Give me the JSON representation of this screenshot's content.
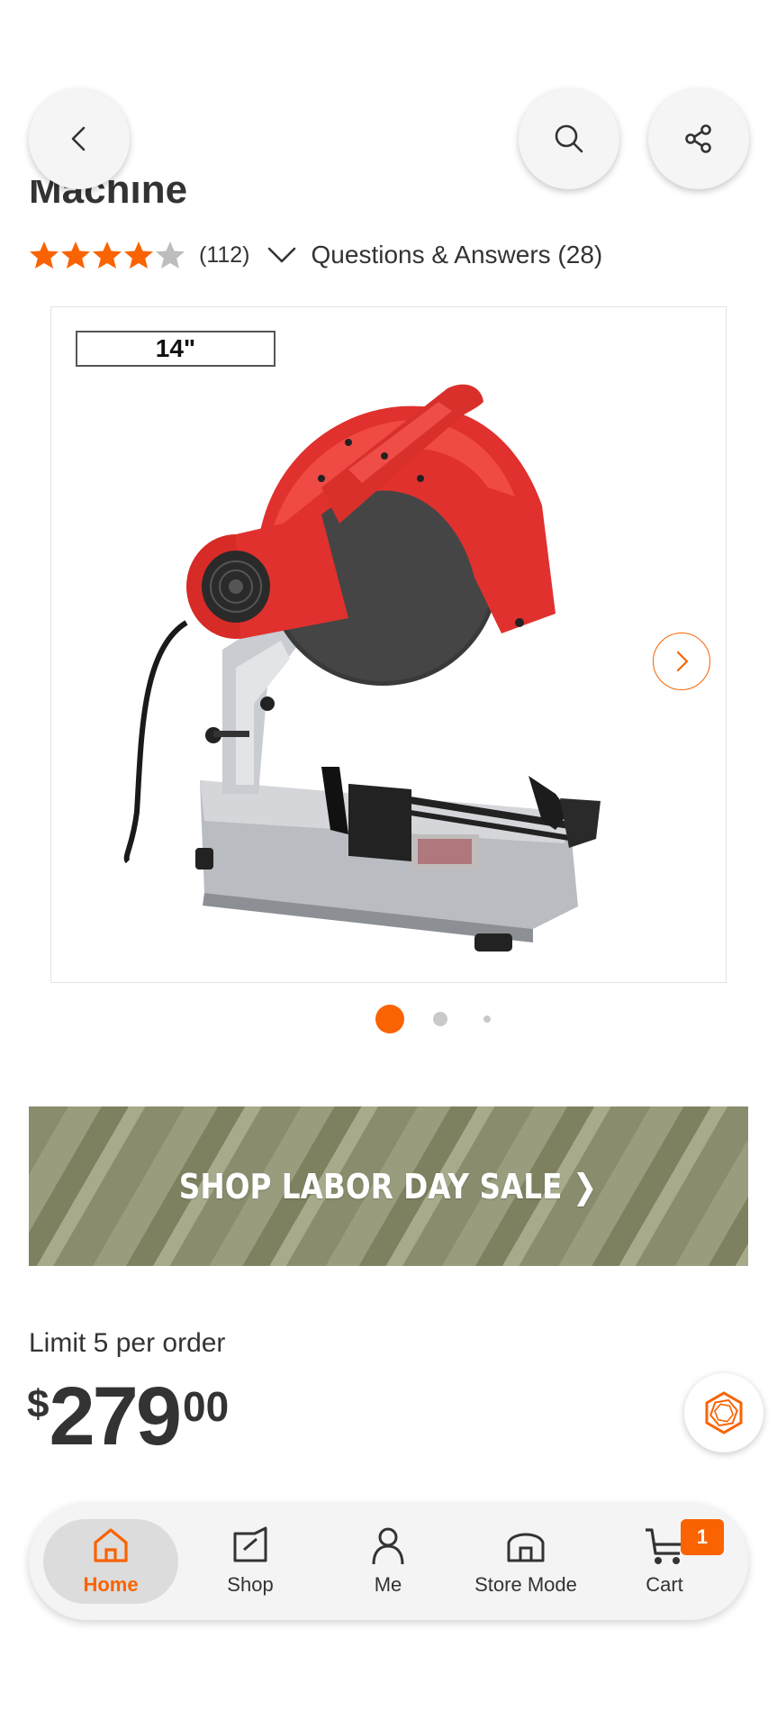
{
  "product": {
    "title_partial": "Machine",
    "rating": 4,
    "rating_max": 5,
    "review_count": "(112)",
    "qa_link": "Questions & Answers (28)"
  },
  "gallery": {
    "size_badge": "14\"",
    "image_count": 3,
    "active_index": 1
  },
  "promo": {
    "label": "SHOP LABOR DAY SALE ❯"
  },
  "pricing": {
    "limit_text": "Limit 5 per order",
    "currency": "$",
    "dollars": "279",
    "cents": "00"
  },
  "header": {
    "back_icon": "chevron-left-icon",
    "search_icon": "search-icon",
    "share_icon": "share-icon"
  },
  "bottom_nav": {
    "items": [
      {
        "label": "Home",
        "icon": "house-icon",
        "active": true
      },
      {
        "label": "Shop",
        "icon": "shop-icon"
      },
      {
        "label": "Me",
        "icon": "person-icon"
      },
      {
        "label": "Store Mode",
        "icon": "store-icon"
      },
      {
        "label": "Cart",
        "icon": "cart-icon"
      }
    ],
    "cart_badge": "1"
  },
  "colors": {
    "accent": "#f96302",
    "text": "#333333",
    "promo_bg": "#8a8c6e"
  }
}
